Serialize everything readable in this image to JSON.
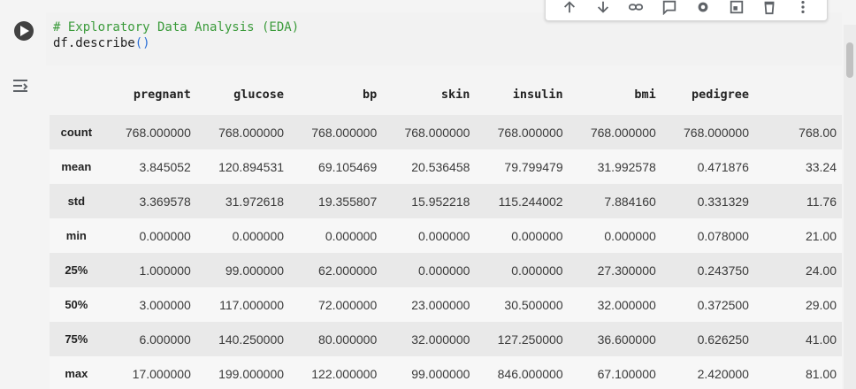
{
  "code": {
    "comment": "# Exploratory Data Analysis (EDA)",
    "line2_ident": "df.describe",
    "line2_parens": "()"
  },
  "toolbar": {
    "icons": [
      "move-up-icon",
      "move-down-icon",
      "link-icon",
      "comment-icon",
      "settings-gear-icon",
      "mirror-cell-icon",
      "delete-icon",
      "more-vert-icon"
    ]
  },
  "table": {
    "columns": [
      "pregnant",
      "glucose",
      "bp",
      "skin",
      "insulin",
      "bmi",
      "pedigree"
    ],
    "rows": [
      {
        "label": "count",
        "values": [
          "768.000000",
          "768.000000",
          "768.000000",
          "768.000000",
          "768.000000",
          "768.000000",
          "768.000000",
          "768.00"
        ]
      },
      {
        "label": "mean",
        "values": [
          "3.845052",
          "120.894531",
          "69.105469",
          "20.536458",
          "79.799479",
          "31.992578",
          "0.471876",
          "33.24"
        ]
      },
      {
        "label": "std",
        "values": [
          "3.369578",
          "31.972618",
          "19.355807",
          "15.952218",
          "115.244002",
          "7.884160",
          "0.331329",
          "11.76"
        ]
      },
      {
        "label": "min",
        "values": [
          "0.000000",
          "0.000000",
          "0.000000",
          "0.000000",
          "0.000000",
          "0.000000",
          "0.078000",
          "21.00"
        ]
      },
      {
        "label": "25%",
        "values": [
          "1.000000",
          "99.000000",
          "62.000000",
          "0.000000",
          "0.000000",
          "27.300000",
          "0.243750",
          "24.00"
        ]
      },
      {
        "label": "50%",
        "values": [
          "3.000000",
          "117.000000",
          "72.000000",
          "23.000000",
          "30.500000",
          "32.000000",
          "0.372500",
          "29.00"
        ]
      },
      {
        "label": "75%",
        "values": [
          "6.000000",
          "140.250000",
          "80.000000",
          "32.000000",
          "127.250000",
          "36.600000",
          "0.626250",
          "41.00"
        ]
      },
      {
        "label": "max",
        "values": [
          "17.000000",
          "199.000000",
          "122.000000",
          "99.000000",
          "846.000000",
          "67.100000",
          "2.420000",
          "81.00"
        ]
      }
    ]
  }
}
